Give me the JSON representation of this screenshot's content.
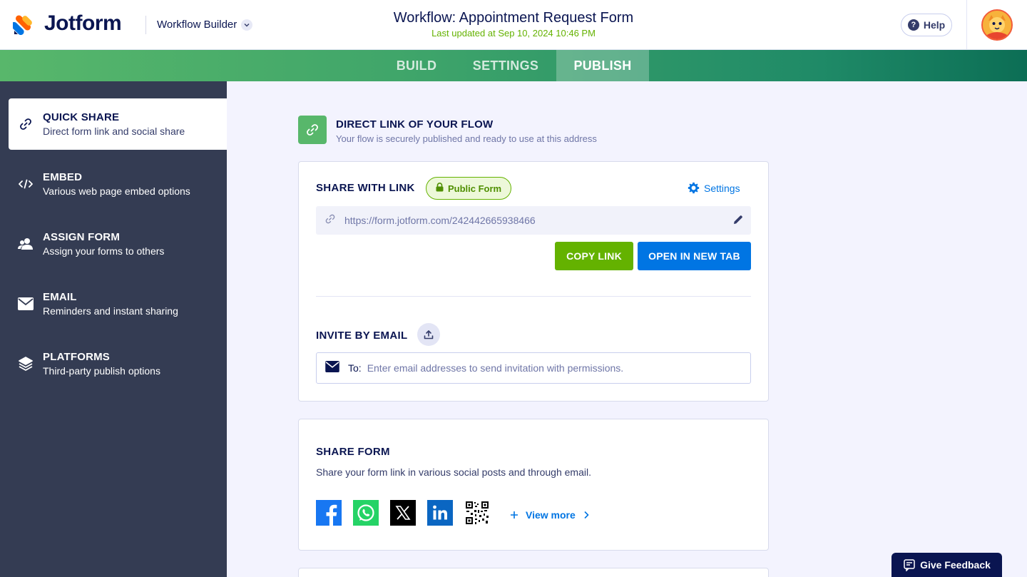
{
  "app": {
    "logo_text": "Jotform",
    "builder_label": "Workflow Builder",
    "workflow_title": "Workflow: Appointment Request Form",
    "last_updated": "Last updated at Sep 10, 2024 10:46 PM",
    "help_label": "Help"
  },
  "tabs": [
    {
      "label": "BUILD",
      "active": false
    },
    {
      "label": "SETTINGS",
      "active": false
    },
    {
      "label": "PUBLISH",
      "active": true
    }
  ],
  "sidebar": {
    "items": [
      {
        "title": "QUICK SHARE",
        "desc": "Direct form link and social share",
        "icon": "link-icon",
        "active": true
      },
      {
        "title": "EMBED",
        "desc": "Various web page embed options",
        "icon": "code-icon",
        "active": false
      },
      {
        "title": "ASSIGN FORM",
        "desc": "Assign your forms to others",
        "icon": "users-icon",
        "active": false
      },
      {
        "title": "EMAIL",
        "desc": "Reminders and instant sharing",
        "icon": "envelope-icon",
        "active": false
      },
      {
        "title": "PLATFORMS",
        "desc": "Third-party publish options",
        "icon": "layers-icon",
        "active": false
      }
    ]
  },
  "direct_link": {
    "title": "DIRECT LINK OF YOUR FLOW",
    "subtitle": "Your flow is securely published and ready to use at this address"
  },
  "share_link": {
    "label": "SHARE WITH LINK",
    "badge": "Public Form",
    "settings_label": "Settings",
    "url": "https://form.jotform.com/242442665938466",
    "copy_button": "COPY LINK",
    "open_button": "OPEN IN NEW TAB"
  },
  "invite": {
    "label": "INVITE BY EMAIL",
    "to_label": "To:",
    "placeholder": "Enter email addresses to send invitation with permissions.",
    "value": ""
  },
  "share_form": {
    "label": "SHARE FORM",
    "description": "Share your form link in various social posts and through email.",
    "socials": [
      "facebook-icon",
      "whatsapp-icon",
      "x-icon",
      "linkedin-icon",
      "qr-code-icon"
    ],
    "view_more": "View more"
  },
  "feedback": {
    "label": "Give Feedback"
  },
  "colors": {
    "accent_green": "#64b200",
    "accent_blue": "#0075e3",
    "navy": "#0a1551",
    "sidebar_bg": "#343c53"
  }
}
